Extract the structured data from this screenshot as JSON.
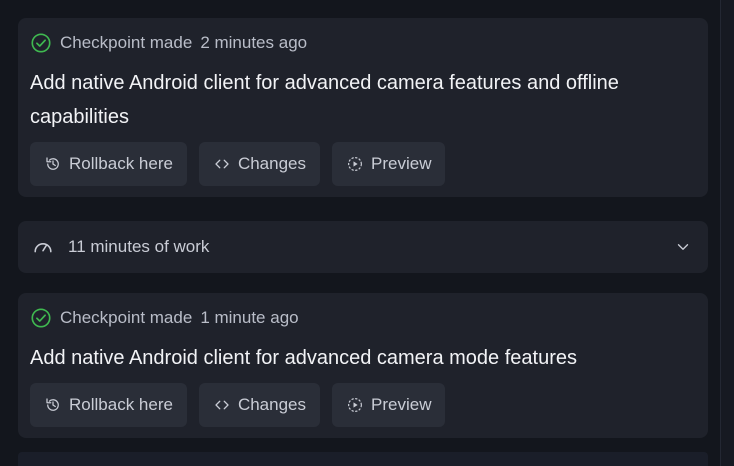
{
  "checkpoints": [
    {
      "status": "Checkpoint made",
      "time": "2 minutes ago",
      "title": "Add native Android client for advanced camera features and offline capabilities",
      "actions": {
        "rollback": "Rollback here",
        "changes": "Changes",
        "preview": "Preview"
      }
    },
    {
      "status": "Checkpoint made",
      "time": "1 minute ago",
      "title": "Add native Android client for advanced camera mode features",
      "actions": {
        "rollback": "Rollback here",
        "changes": "Changes",
        "preview": "Preview"
      }
    }
  ],
  "work_summary": {
    "label": "11 minutes of work"
  },
  "colors": {
    "success": "#3fb950",
    "card": "#1f222b",
    "button": "#2a2e38"
  },
  "icons": [
    "check-circle-icon",
    "rollback-icon",
    "code-icon",
    "preview-icon",
    "speedometer-icon",
    "chevron-down-icon"
  ]
}
